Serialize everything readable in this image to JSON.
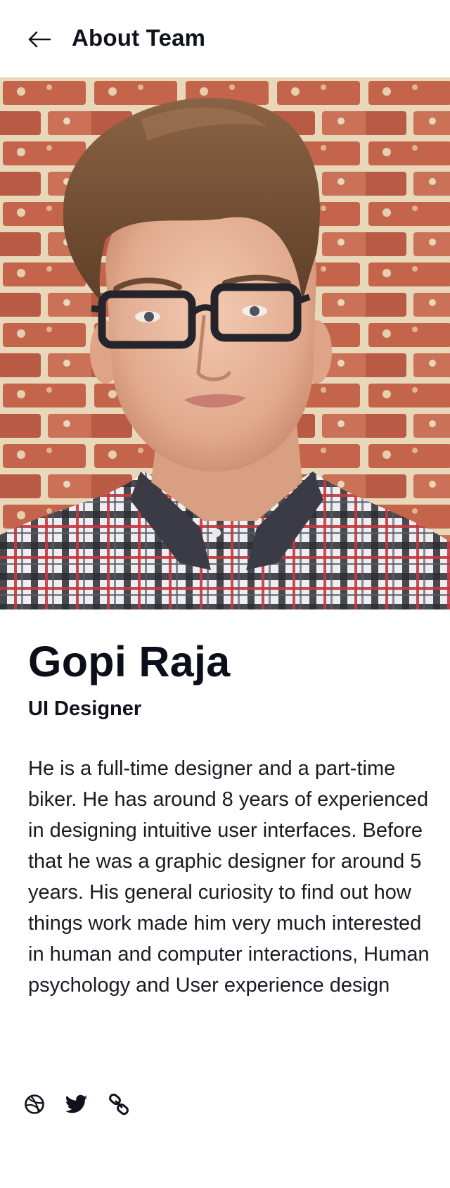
{
  "header": {
    "title": "About Team",
    "back_icon": "arrow-left-icon"
  },
  "profile": {
    "photo": "portrait-photo",
    "name": "Gopi Raja",
    "role": "UI Designer",
    "bio": "He is a full-time designer and a part-time biker. He has around 8 years of experienced in designing intuitive user interfaces. Before that he was a graphic designer for around 5 years. His general curiosity to find out how things work made him very much interested in human and computer interactions, Human psychology and User experience design"
  },
  "social": {
    "icons": [
      "dribbble-icon",
      "twitter-icon",
      "link-icon"
    ]
  },
  "colors": {
    "text": "#11111d",
    "background": "#ffffff"
  }
}
